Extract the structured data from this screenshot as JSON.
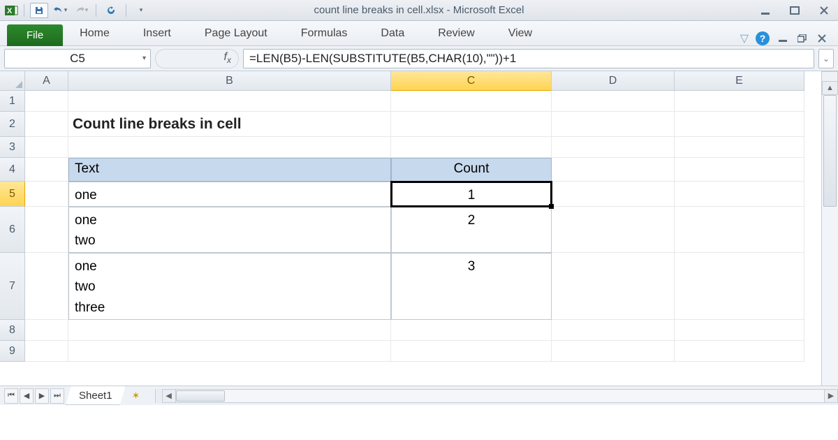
{
  "title": "count line breaks in cell.xlsx  -  Microsoft Excel",
  "ribbon": {
    "file": "File",
    "tabs": [
      "Home",
      "Insert",
      "Page Layout",
      "Formulas",
      "Data",
      "Review",
      "View"
    ]
  },
  "namebox": "C5",
  "formula": "=LEN(B5)-LEN(SUBSTITUTE(B5,CHAR(10),\"\"))+1",
  "columns": [
    "A",
    "B",
    "C",
    "D",
    "E"
  ],
  "active_column": "C",
  "rows": [
    "1",
    "2",
    "3",
    "4",
    "5",
    "6",
    "7",
    "8",
    "9"
  ],
  "active_row": "5",
  "sheet": {
    "title": "Count line breaks in cell",
    "headers": {
      "text": "Text",
      "count": "Count"
    },
    "data": [
      {
        "text": "one",
        "count": "1"
      },
      {
        "text": "one\ntwo",
        "count": "2"
      },
      {
        "text": "one\ntwo\nthree",
        "count": "3"
      }
    ]
  },
  "tabs": {
    "sheet1": "Sheet1"
  }
}
